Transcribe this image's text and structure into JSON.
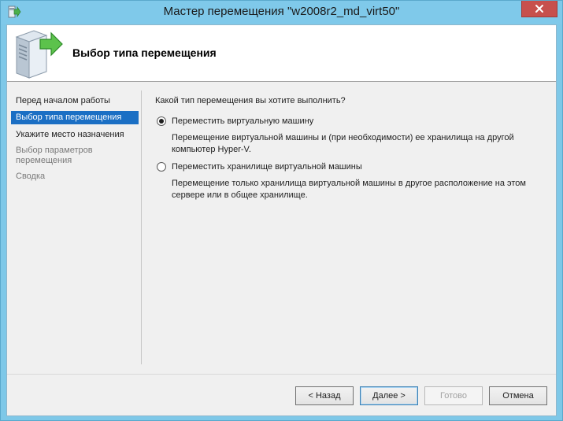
{
  "window": {
    "title": "Мастер перемещения \"w2008r2_md_virt50\"",
    "accent_color": "#7fc9ea",
    "close_color": "#c7504d"
  },
  "header": {
    "page_title": "Выбор типа перемещения",
    "icon": "server-move-icon"
  },
  "nav": {
    "items": [
      {
        "label": "Перед началом работы",
        "state": "normal"
      },
      {
        "label": "Выбор типа перемещения",
        "state": "active"
      },
      {
        "label": "Укажите место назначения",
        "state": "normal"
      },
      {
        "label": "Выбор параметров перемещения",
        "state": "disabled"
      },
      {
        "label": "Сводка",
        "state": "disabled"
      }
    ]
  },
  "main": {
    "question": "Какой тип перемещения вы хотите выполнить?",
    "options": [
      {
        "label": "Переместить виртуальную машину",
        "description": "Перемещение виртуальной машины и (при необходимости) ее хранилища на другой компьютер Hyper-V.",
        "checked": true
      },
      {
        "label": "Переместить хранилище виртуальной машины",
        "description": "Перемещение только хранилища виртуальной машины в другое расположение на этом сервере или в общее хранилище.",
        "checked": false
      }
    ]
  },
  "footer": {
    "back_label": "< Назад",
    "next_label": "Далее >",
    "finish_label": "Готово",
    "cancel_label": "Отмена"
  }
}
